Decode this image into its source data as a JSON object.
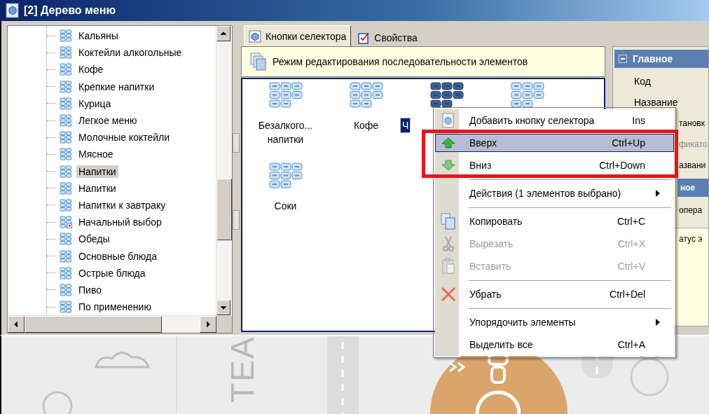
{
  "window": {
    "title": "[2] Дерево меню"
  },
  "tree": {
    "items": [
      {
        "label": "Кальяны",
        "kind": "group",
        "selected": false
      },
      {
        "label": "Коктейли алкогольные",
        "kind": "group",
        "selected": false
      },
      {
        "label": "Кофе",
        "kind": "group",
        "selected": false
      },
      {
        "label": "Крепкие напитки",
        "kind": "group",
        "selected": false
      },
      {
        "label": "Курица",
        "kind": "group",
        "selected": false
      },
      {
        "label": "Легкое меню",
        "kind": "group",
        "selected": false
      },
      {
        "label": "Молочные коктейли",
        "kind": "group",
        "selected": false
      },
      {
        "label": "Мясное",
        "kind": "group",
        "selected": false
      },
      {
        "label": "Напитки",
        "kind": "group",
        "selected": true
      },
      {
        "label": "Напитки",
        "kind": "group",
        "selected": false
      },
      {
        "label": "Напитки к завтраку",
        "kind": "group",
        "selected": false
      },
      {
        "label": "Начальный выбор",
        "kind": "start",
        "selected": false
      },
      {
        "label": "Обеды",
        "kind": "group",
        "selected": false
      },
      {
        "label": "Основные блюда",
        "kind": "group",
        "selected": false
      },
      {
        "label": "Острые блюда",
        "kind": "group",
        "selected": false
      },
      {
        "label": "Пиво",
        "kind": "group",
        "selected": false
      },
      {
        "label": "По применению",
        "kind": "group",
        "selected": false
      }
    ]
  },
  "tabs": [
    {
      "label": "Кнопки селектора",
      "selected": true
    },
    {
      "label": "Свойства",
      "selected": false
    }
  ],
  "info_bar": {
    "text": "Режим редактирования последовательности элементов"
  },
  "selector_buttons": [
    {
      "label": "Безалкого... напитки",
      "selected": false
    },
    {
      "label": "Кофе",
      "selected": false
    },
    {
      "label": "Ч",
      "selected": true
    },
    {
      "selected": false
    },
    {
      "label": "Соки",
      "selected": false
    }
  ],
  "properties": [
    {
      "kind": "header",
      "text": "Главное"
    },
    {
      "kind": "field",
      "text": "Код"
    },
    {
      "kind": "field",
      "text": "Название"
    },
    {
      "kind": "cut",
      "text": "тановк"
    },
    {
      "kind": "cut-grey",
      "text": "фикато"
    },
    {
      "kind": "cut",
      "text": "азвани"
    },
    {
      "kind": "cut-header",
      "text": "ное"
    },
    {
      "kind": "cut",
      "text": "опера"
    },
    {
      "kind": "cut-note",
      "text": "атус э"
    }
  ],
  "context_menu": [
    {
      "kind": "item",
      "label": "Добавить кнопку селектора",
      "shortcut": "Ins",
      "disabled": false,
      "selected": false
    },
    {
      "kind": "item",
      "label": "Вверх",
      "shortcut": "Ctrl+Up",
      "disabled": false,
      "selected": true
    },
    {
      "kind": "item",
      "label": "Вниз",
      "shortcut": "Ctrl+Down",
      "disabled": false,
      "selected": false
    },
    {
      "kind": "separator"
    },
    {
      "kind": "submenu",
      "label": "Действия (1 элементов выбрано)",
      "disabled": false,
      "selected": false
    },
    {
      "kind": "separator"
    },
    {
      "kind": "item",
      "label": "Копировать",
      "shortcut": "Ctrl+C",
      "disabled": false,
      "selected": false
    },
    {
      "kind": "item",
      "label": "Вырезать",
      "shortcut": "Ctrl+X",
      "disabled": true,
      "selected": false
    },
    {
      "kind": "item",
      "label": "Вставить",
      "shortcut": "Ctrl+V",
      "disabled": true,
      "selected": false
    },
    {
      "kind": "separator"
    },
    {
      "kind": "item",
      "label": "Убрать",
      "shortcut": "Ctrl+Del",
      "disabled": false,
      "selected": false
    },
    {
      "kind": "separator"
    },
    {
      "kind": "submenu",
      "label": "Упорядочить элементы",
      "disabled": false,
      "selected": false
    },
    {
      "kind": "item",
      "label": "Выделить все",
      "shortcut": "Ctrl+A",
      "disabled": false,
      "selected": false
    }
  ],
  "background": {
    "text": "TEA"
  }
}
